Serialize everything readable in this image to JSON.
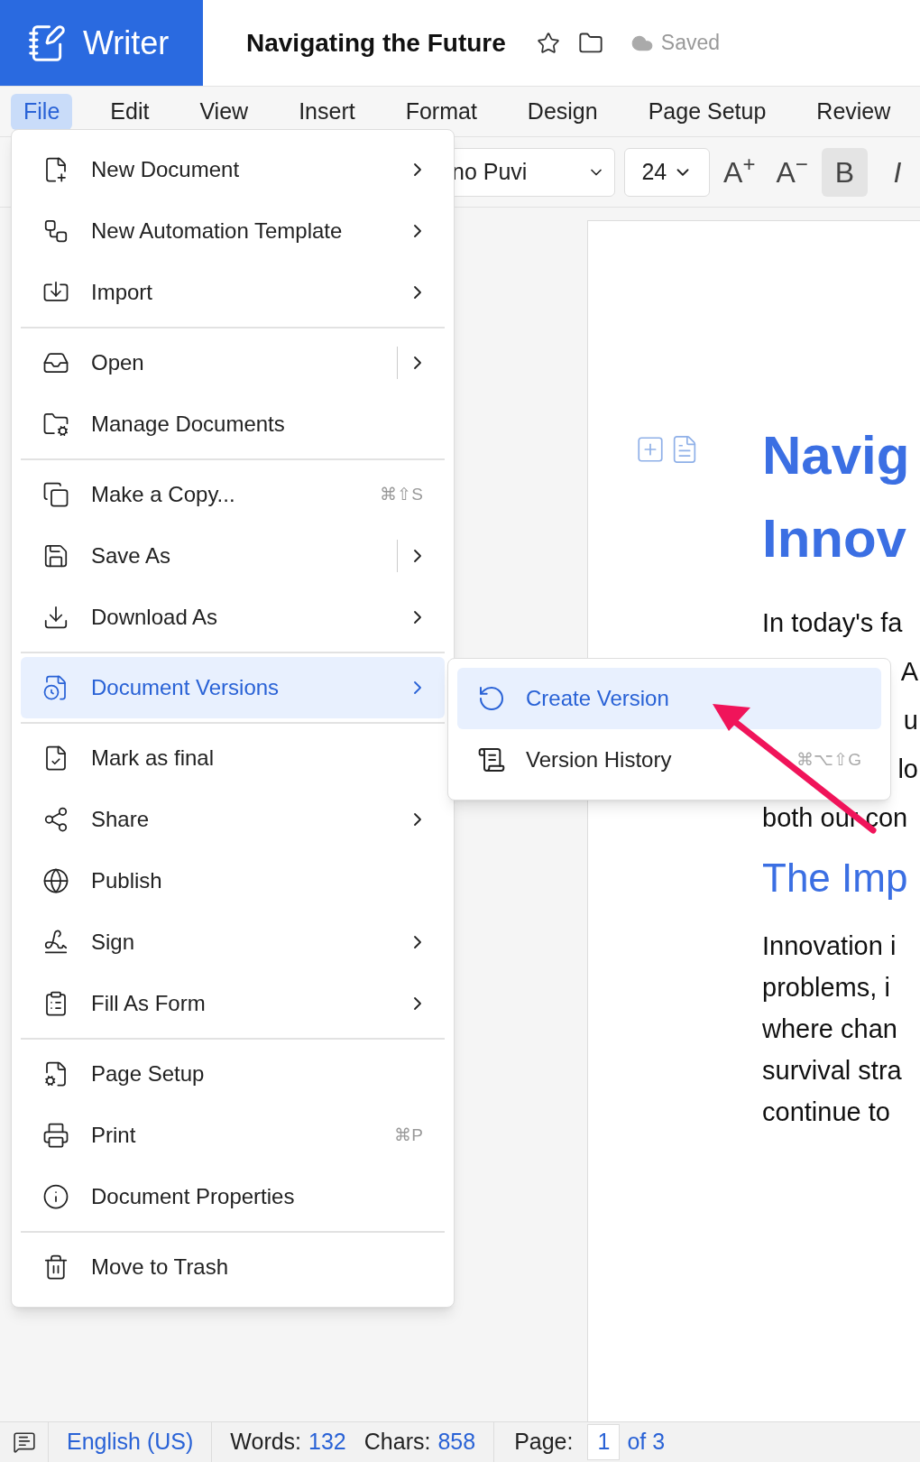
{
  "header": {
    "app_name": "Writer",
    "doc_title": "Navigating the Future",
    "save_status": "Saved"
  },
  "menu_bar": {
    "items": [
      {
        "label": "File",
        "selected": true
      },
      {
        "label": "Edit",
        "selected": false
      },
      {
        "label": "View",
        "selected": false
      },
      {
        "label": "Insert",
        "selected": false
      },
      {
        "label": "Format",
        "selected": false
      },
      {
        "label": "Design",
        "selected": false
      },
      {
        "label": "Page Setup",
        "selected": false
      },
      {
        "label": "Review",
        "selected": false
      }
    ]
  },
  "toolbar": {
    "font_name": "no Puvi",
    "font_size": "24",
    "buttons": [
      {
        "label": "A$^{+}$",
        "selected": false,
        "italic": false
      },
      {
        "label": "A$^{−}$",
        "selected": false,
        "italic": false
      },
      {
        "label": "B",
        "selected": true,
        "italic": false
      },
      {
        "label": "I",
        "selected": false,
        "italic": true
      }
    ]
  },
  "document": {
    "heading_lines": [
      "Navig",
      "Innov"
    ],
    "paragraph_1": [
      {
        "text": "In today's fa",
        "kind": "full"
      },
      {
        "text": "A",
        "kind": "tail"
      },
      {
        "text": "u",
        "kind": "tail"
      },
      {
        "text": "lo",
        "kind": "tail"
      },
      {
        "text": "both our con",
        "kind": "full"
      }
    ],
    "subheading": "The Imp",
    "paragraph_2": [
      "Innovation i",
      "problems, i",
      "where chan",
      "survival stra",
      "continue to"
    ]
  },
  "file_menu": {
    "items": [
      {
        "kind": "item",
        "label": "New Document",
        "has_submenu": true,
        "selected": false
      },
      {
        "kind": "item",
        "label": "New Automation Template",
        "has_submenu": true,
        "selected": false
      },
      {
        "kind": "item",
        "label": "Import",
        "has_submenu": true,
        "selected": false
      },
      {
        "kind": "divider"
      },
      {
        "kind": "item",
        "label": "Open",
        "has_submenu": true,
        "split": true,
        "selected": false
      },
      {
        "kind": "item",
        "label": "Manage Documents",
        "has_submenu": false,
        "selected": false
      },
      {
        "kind": "divider"
      },
      {
        "kind": "item",
        "label": "Make a Copy...",
        "shortcut": "⌘⇧S",
        "has_submenu": false,
        "selected": false
      },
      {
        "kind": "item",
        "label": "Save As",
        "has_submenu": true,
        "split": true,
        "selected": false
      },
      {
        "kind": "item",
        "label": "Download As",
        "has_submenu": true,
        "selected": false
      },
      {
        "kind": "divider"
      },
      {
        "kind": "item",
        "label": "Document Versions",
        "has_submenu": true,
        "selected": true
      },
      {
        "kind": "divider"
      },
      {
        "kind": "item",
        "label": "Mark as final",
        "has_submenu": false,
        "selected": false
      },
      {
        "kind": "item",
        "label": "Share",
        "has_submenu": true,
        "selected": false
      },
      {
        "kind": "item",
        "label": "Publish",
        "has_submenu": false,
        "selected": false
      },
      {
        "kind": "item",
        "label": "Sign",
        "has_submenu": true,
        "selected": false
      },
      {
        "kind": "item",
        "label": "Fill As Form",
        "has_submenu": true,
        "selected": false
      },
      {
        "kind": "divider"
      },
      {
        "kind": "item",
        "label": "Page Setup",
        "has_submenu": false,
        "selected": false
      },
      {
        "kind": "item",
        "label": "Print",
        "shortcut": "⌘P",
        "has_submenu": false,
        "selected": false
      },
      {
        "kind": "item",
        "label": "Document Properties",
        "has_submenu": false,
        "selected": false
      },
      {
        "kind": "divider"
      },
      {
        "kind": "item",
        "label": "Move to Trash",
        "has_submenu": false,
        "selected": false
      }
    ]
  },
  "versions_submenu": {
    "items": [
      {
        "label": "Create Version",
        "selected": true
      },
      {
        "label": "Version History",
        "shortcut": "⌘⌥⇧G",
        "selected": false
      }
    ]
  },
  "status_bar": {
    "language": "English (US)",
    "words_label": "Words:",
    "words": "132",
    "chars_label": "Chars:",
    "chars": "858",
    "page_label": "Page:",
    "page_current": "1",
    "page_total": "of 3"
  }
}
